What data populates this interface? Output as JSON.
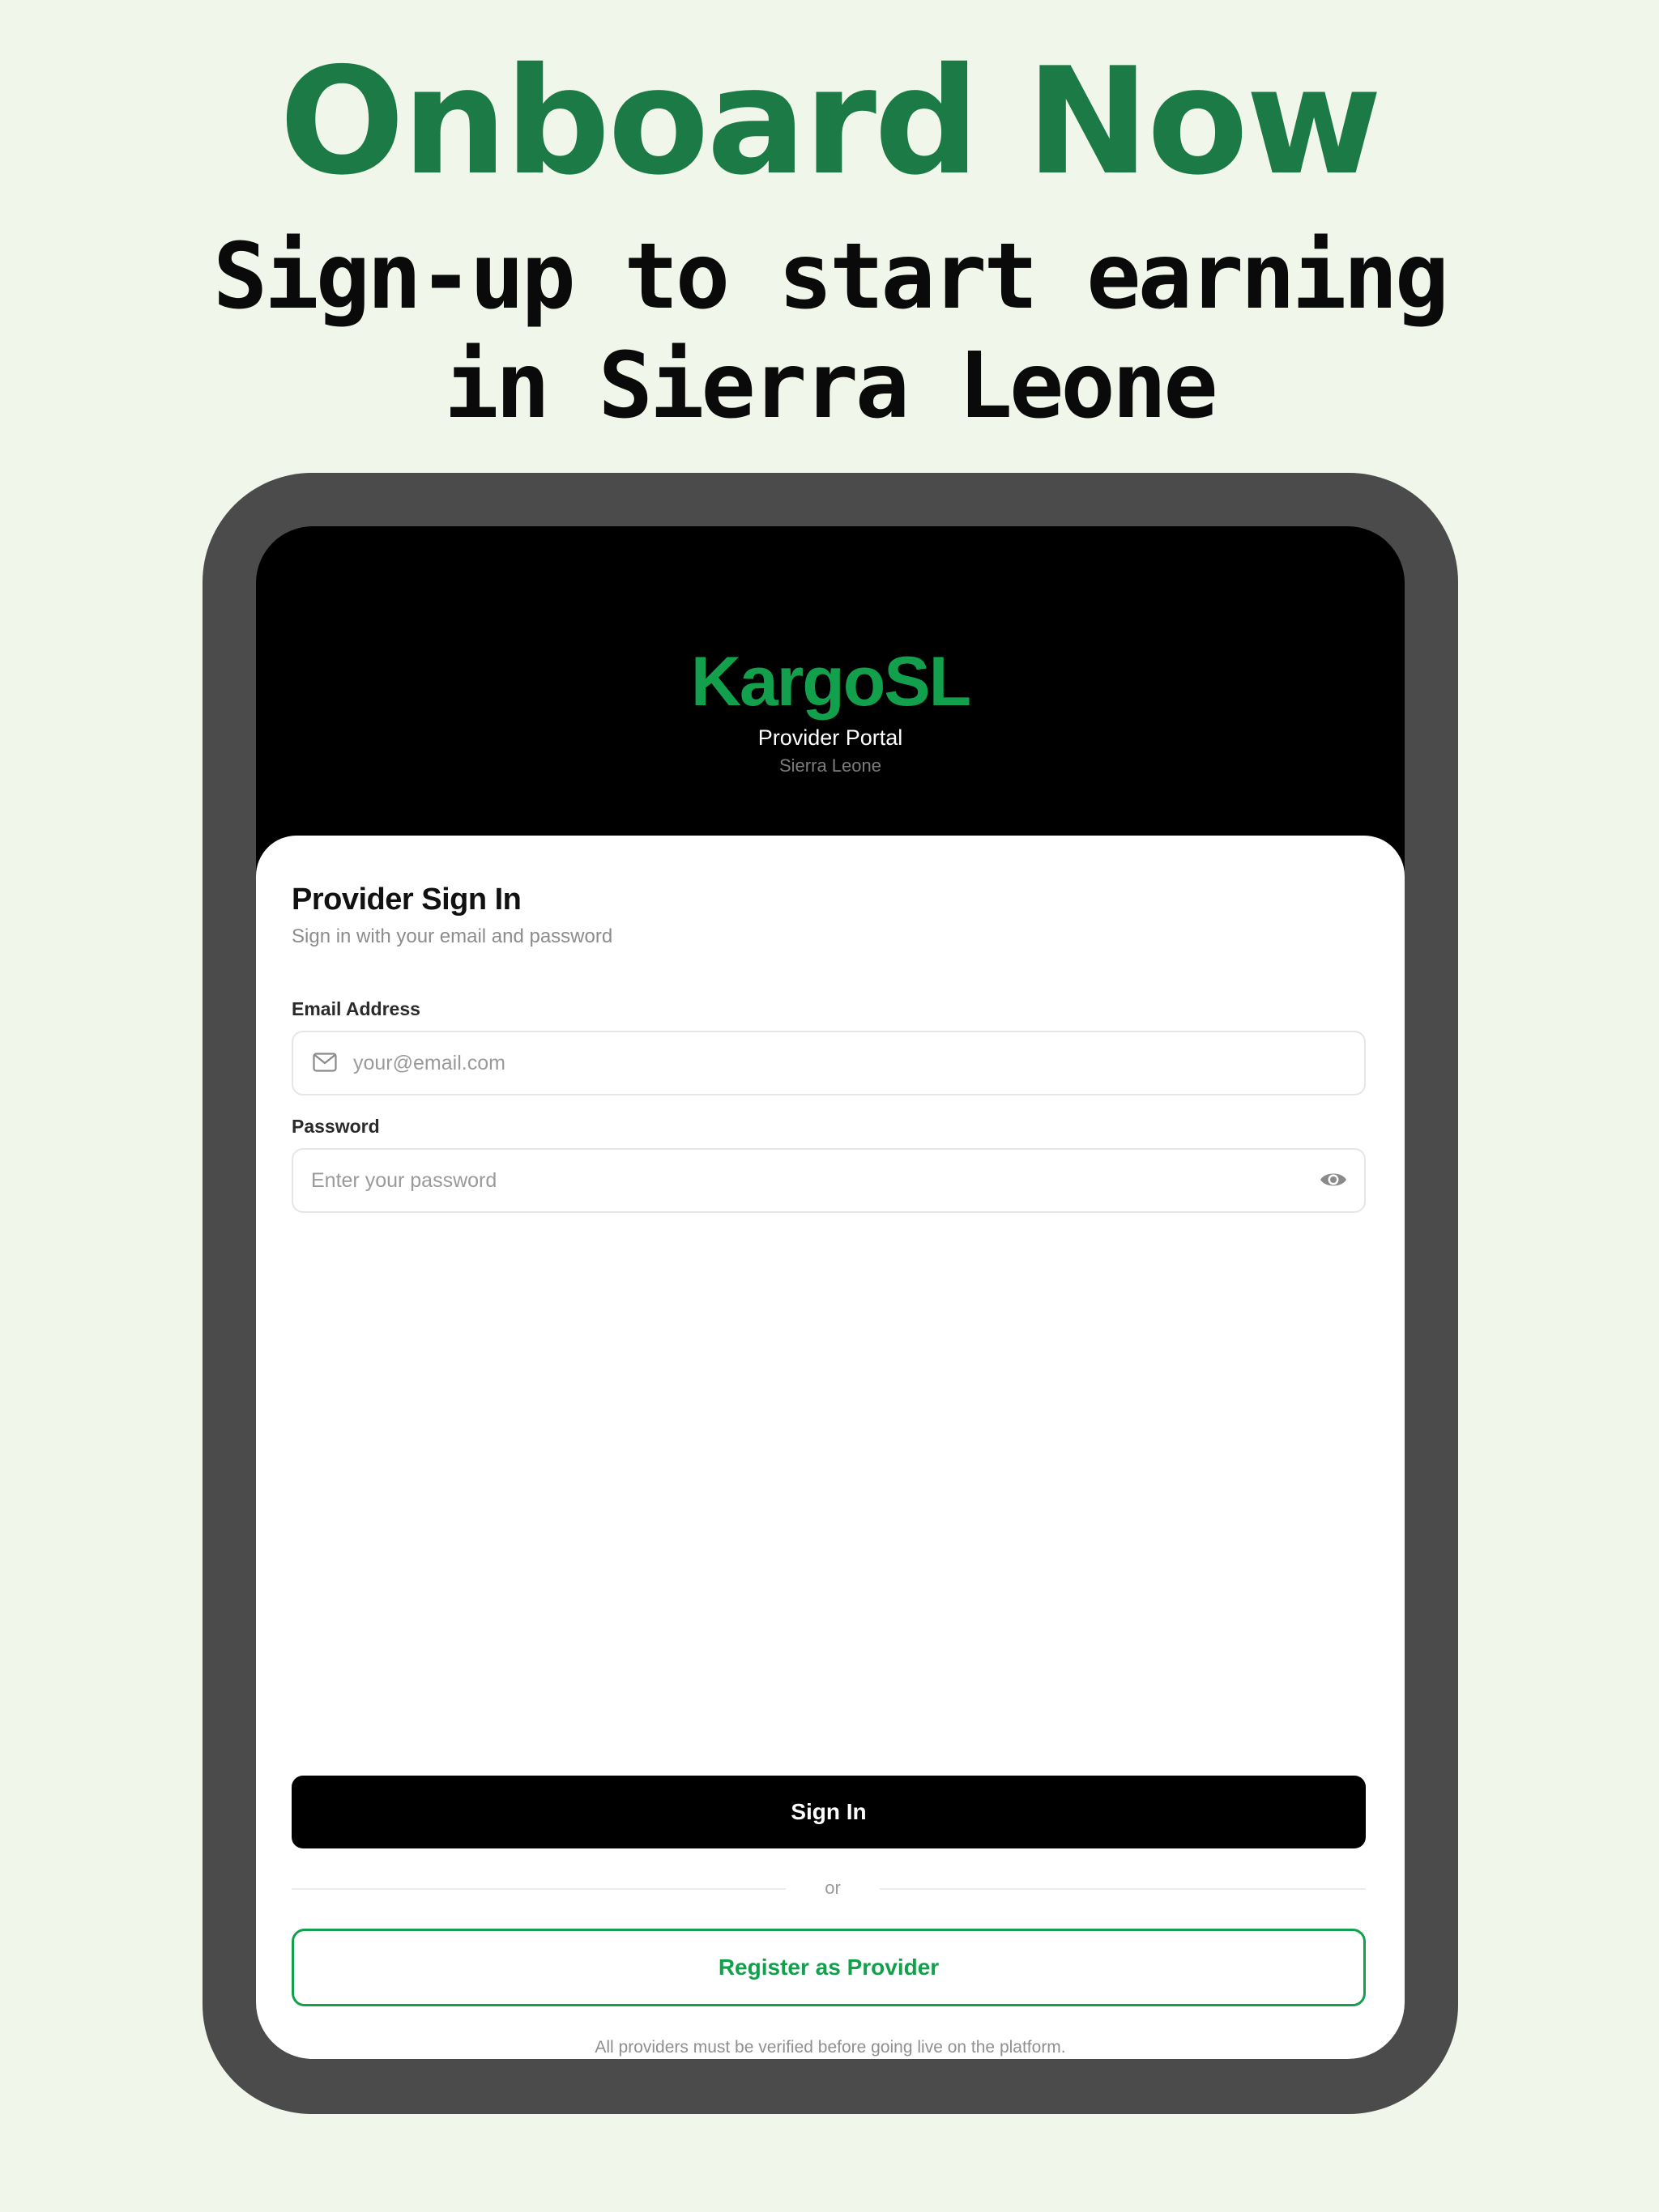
{
  "promo": {
    "headline": "Onboard Now",
    "subheadline_line1": "Sign-up to start earning",
    "subheadline_line2": "in Sierra Leone"
  },
  "app_header": {
    "brand": "KargoSL",
    "portal": "Provider Portal",
    "region": "Sierra Leone"
  },
  "signin_card": {
    "title": "Provider Sign In",
    "subtitle": "Sign in with your email and password",
    "email": {
      "label": "Email Address",
      "value": "",
      "placeholder": "your@email.com",
      "icon": "mail-icon"
    },
    "password": {
      "label": "Password",
      "value": "",
      "placeholder": "Enter your password",
      "icon": "eye-icon"
    },
    "signin_label": "Sign In",
    "divider_text": "or",
    "register_label": "Register as Provider",
    "disclaimer": "All providers must be verified before going live on the platform."
  },
  "colors": {
    "page_background": "#f0f7ea",
    "headline_green": "#1c7a47",
    "brand_green": "#13a04d",
    "tablet_frame": "#4b4b4b",
    "primary_button": "#000000"
  }
}
